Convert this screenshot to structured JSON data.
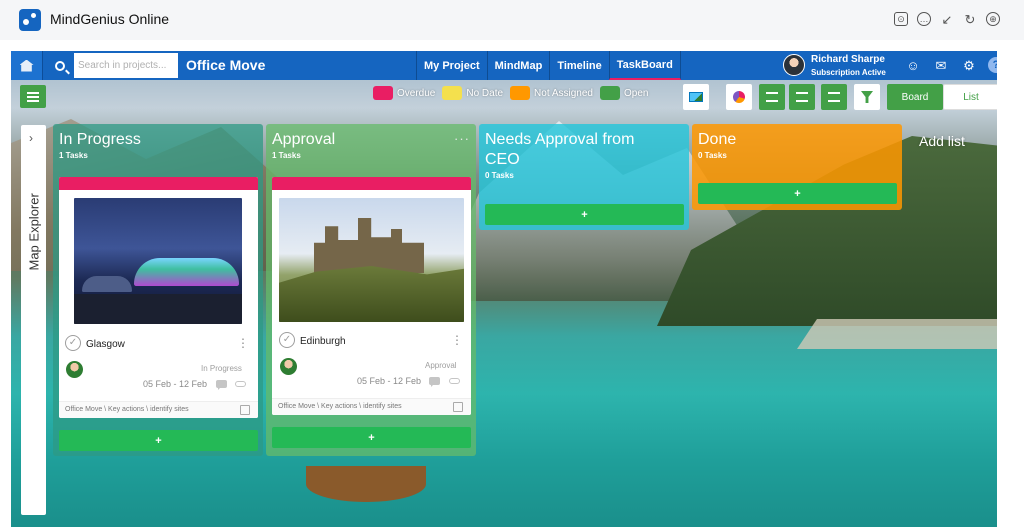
{
  "window": {
    "app_title": "MindGenius Online"
  },
  "window_icons": [
    "screenshot-icon",
    "chat-icon",
    "minimize-icon",
    "refresh-icon",
    "globe-icon"
  ],
  "nav": {
    "search_placeholder": "Search in projects...",
    "project_title": "Office Move",
    "tabs": [
      {
        "label": "My Project",
        "active": false
      },
      {
        "label": "MindMap",
        "active": false
      },
      {
        "label": "Timeline",
        "active": false
      },
      {
        "label": "TaskBoard",
        "active": true
      }
    ],
    "user": {
      "name": "Richard Sharpe",
      "status": "Subscription Active"
    },
    "help": "?"
  },
  "legend": [
    {
      "label": "Overdue",
      "color": "#e91e63"
    },
    {
      "label": "No Date",
      "color": "#f4e04d"
    },
    {
      "label": "Not Assigned",
      "color": "#ff9800"
    },
    {
      "label": "Open",
      "color": "#43a047"
    }
  ],
  "view_toggle": {
    "board": "Board",
    "list": "List",
    "active": "board"
  },
  "map_explorer": {
    "label": "Map Explorer",
    "chevron": "›"
  },
  "board": {
    "add_list_label": "Add list",
    "add_label": "+",
    "menu_glyph": "···",
    "lists": [
      {
        "title": "In Progress",
        "count": "1 Tasks",
        "color": "#2e9a84",
        "cards": [
          {
            "name": "Glasgow",
            "status": "In Progress",
            "dates": "05 Feb - 12 Feb",
            "path": "Office Move \\ Key actions \\ identify sites",
            "strip_color": "#e91e63"
          }
        ]
      },
      {
        "title": "Approval",
        "count": "1 Tasks",
        "color": "#66bb6a",
        "cards": [
          {
            "name": "Edinburgh",
            "status": "Approval",
            "dates": "05 Feb - 12 Feb",
            "path": "Office Move \\ Key actions \\ identify sites",
            "strip_color": "#e91e63"
          }
        ]
      },
      {
        "title": "Needs Approval from CEO",
        "count": "0 Tasks",
        "color": "#26c6da",
        "cards": []
      },
      {
        "title": "Done",
        "count": "0 Tasks",
        "color": "#ff9800",
        "cards": []
      }
    ]
  }
}
